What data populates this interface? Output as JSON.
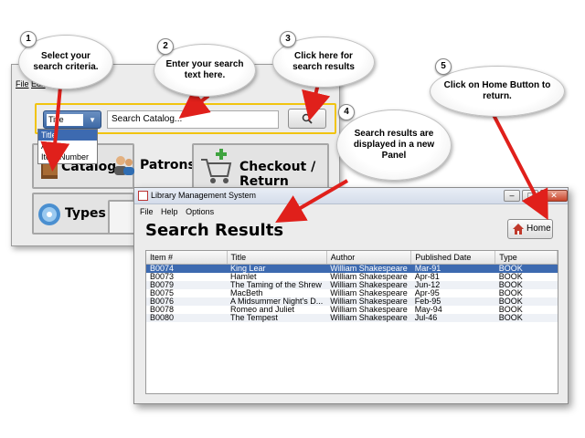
{
  "main_window": {
    "menu": [
      "File",
      "Edit"
    ],
    "criteria_selected": "Title",
    "criteria_options": [
      "Title",
      "Author",
      "Item Number"
    ],
    "search_placeholder": "Search Catalog...",
    "tiles": [
      "Catalog",
      "Patrons",
      "Checkout / Return",
      "Types"
    ]
  },
  "results_window": {
    "title": "Library Management System",
    "menu": [
      "File",
      "Help",
      "Options"
    ],
    "heading": "Search Results",
    "home_label": "Home",
    "columns": [
      "Item #",
      "Title",
      "Author",
      "Published Date",
      "Type"
    ],
    "rows": [
      [
        "B0074",
        "King Lear",
        "William Shakespeare",
        "Mar-91",
        "BOOK"
      ],
      [
        "B0073",
        "Hamlet",
        "William Shakespeare",
        "Apr-81",
        "BOOK"
      ],
      [
        "B0079",
        "The Taming of the Shrew",
        "William Shakespeare",
        "Jun-12",
        "BOOK"
      ],
      [
        "B0075",
        "MacBeth",
        "William Shakespeare",
        "Apr-95",
        "BOOK"
      ],
      [
        "B0076",
        "A Midsummer Night's D...",
        "William Shakespeare",
        "Feb-95",
        "BOOK"
      ],
      [
        "B0078",
        "Romeo and Juliet",
        "William Shakespeare",
        "May-94",
        "BOOK"
      ],
      [
        "B0080",
        "The Tempest",
        "William Shakespeare",
        "Jul-46",
        "BOOK"
      ]
    ]
  },
  "callouts": [
    {
      "n": "1",
      "text": "Select your search criteria."
    },
    {
      "n": "2",
      "text": "Enter your search text here."
    },
    {
      "n": "3",
      "text": "Click here for search results"
    },
    {
      "n": "4",
      "text": "Search results are displayed in a new Panel"
    },
    {
      "n": "5",
      "text": "Click on Home Button to return."
    }
  ],
  "colors": {
    "arrow": "#e0201b",
    "selection": "#3d6ab0",
    "highlight": "#f1c40f"
  },
  "icons": [
    "search-icon",
    "catalog-icon",
    "patrons-icon",
    "cart-icon",
    "types-icon",
    "home-icon",
    "app-icon"
  ]
}
